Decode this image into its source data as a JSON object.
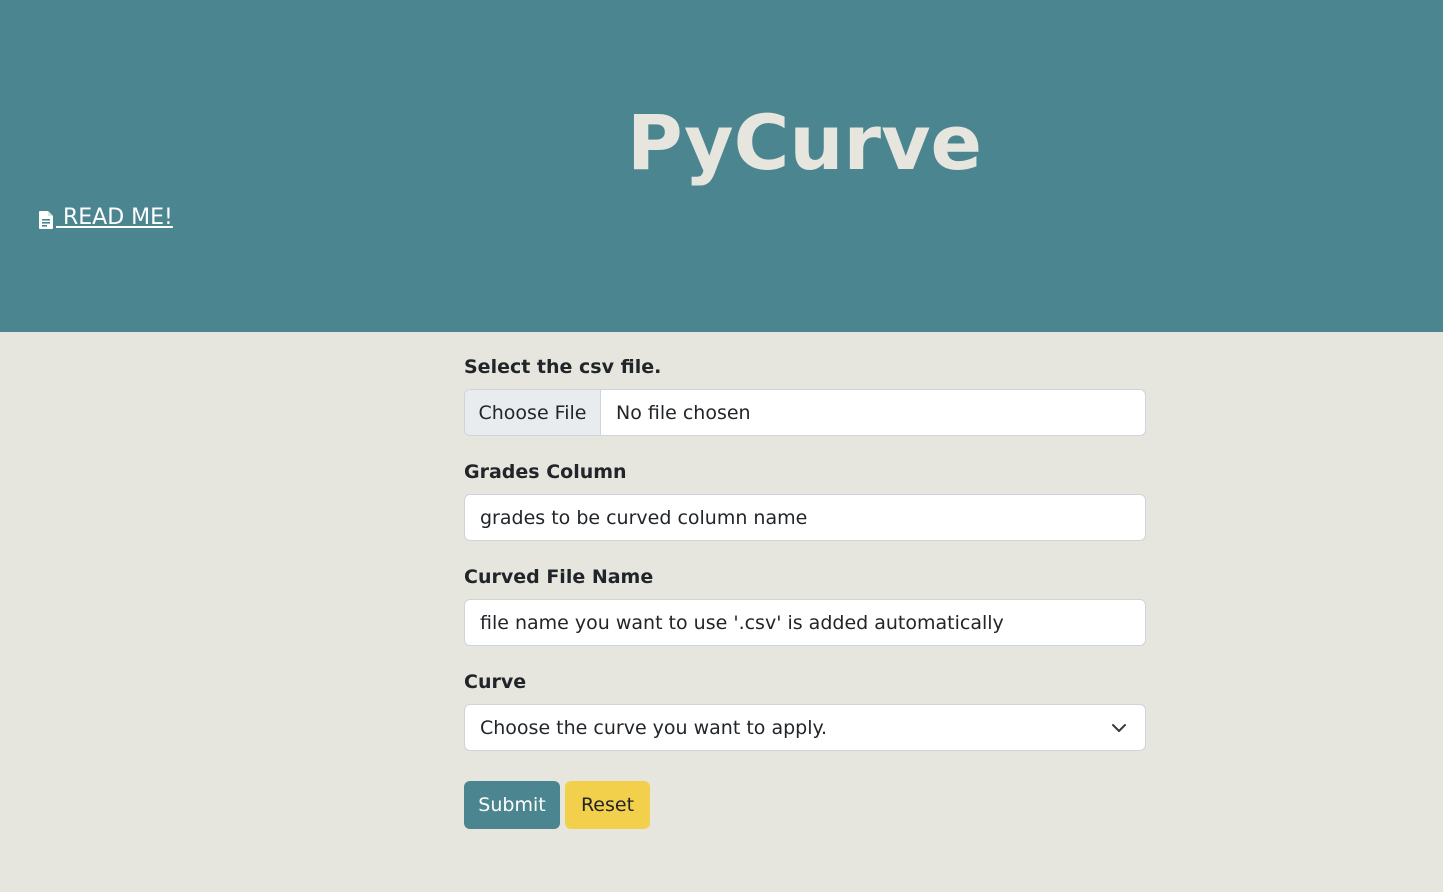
{
  "header": {
    "title": "PyCurve",
    "readme_link": " READ ME!"
  },
  "form": {
    "file": {
      "label": "Select the csv file.",
      "button": "Choose File",
      "status": "No file chosen"
    },
    "grades_column": {
      "label": "Grades Column",
      "placeholder": "grades to be curved column name"
    },
    "curved_file_name": {
      "label": "Curved File Name",
      "placeholder": "file name you want to use '.csv' is added automatically"
    },
    "curve": {
      "label": "Curve",
      "selected": "Choose the curve you want to apply."
    },
    "submit_label": "Submit",
    "reset_label": "Reset"
  },
  "colors": {
    "header_bg": "#4b8690",
    "page_bg": "#e6e5de",
    "submit_bg": "#4b8690",
    "reset_bg": "#f2d04b"
  },
  "icons": {
    "readme": "file-document-icon",
    "select": "chevron-down-icon"
  }
}
